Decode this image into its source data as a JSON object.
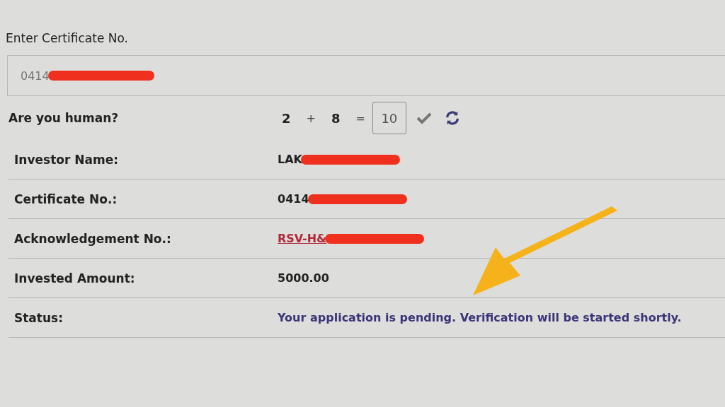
{
  "certificate_field": {
    "label": "Enter Certificate No.",
    "value": "0414",
    "redacted": true
  },
  "captcha": {
    "label": "Are you human?",
    "a": "2",
    "op": "+",
    "b": "8",
    "eq": "=",
    "answer": "10"
  },
  "details": [
    {
      "label": "Investor Name:",
      "value": "LAK",
      "kind": "text",
      "redacted": true
    },
    {
      "label": "Certificate No.:",
      "value": "0414",
      "kind": "text",
      "redacted": true
    },
    {
      "label": "Acknowledgement No.:",
      "value": "RSV-H&",
      "kind": "link",
      "redacted": true
    },
    {
      "label": "Invested Amount:",
      "value": "5000.00",
      "kind": "text"
    },
    {
      "label": "Status:",
      "value": "Your application is pending. Verification will be started shortly.",
      "kind": "status"
    }
  ],
  "annotation": {
    "kind": "arrow",
    "color": "#f5b21a"
  }
}
